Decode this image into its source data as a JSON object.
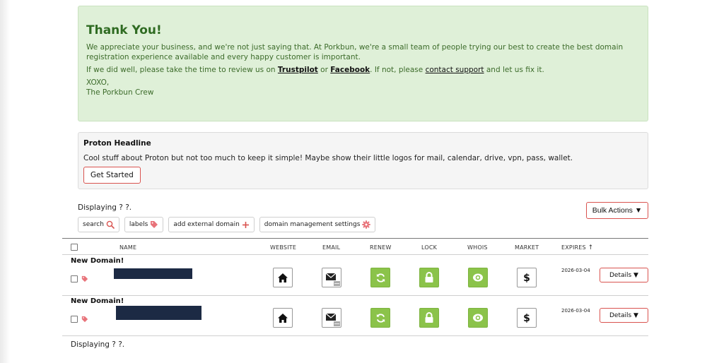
{
  "thanks": {
    "title": "Thank You!",
    "para1": "We appreciate your business, and we're not just saying that. At Porkbun, we're a small team of people trying our best to create the best domain registration experience available and every happy customer is important.",
    "review_prefix": "If we did well, please take the time to review us on ",
    "trustpilot": "Trustpilot",
    "or": " or ",
    "facebook": "Facebook",
    "mid": ". If not, please ",
    "contact_support": "contact support",
    "suffix": " and let us fix it.",
    "xoxo": "XOXO,",
    "crew": "The Porkbun Crew"
  },
  "proton": {
    "headline": "Proton Headline",
    "body": "Cool stuff about Proton but not too much to keep it simple! Maybe show their little logos for mail, calendar, drive, vpn, pass, wallet.",
    "button": "Get Started"
  },
  "list": {
    "displaying": "Displaying ? ?.",
    "bulk_actions": "Bulk Actions ▼",
    "filters": {
      "search": "search",
      "labels": "labels",
      "add_external": "add external domain",
      "settings": "domain management settings"
    }
  },
  "table": {
    "headers": {
      "name": "NAME",
      "website": "WEBSITE",
      "email": "EMAIL",
      "renew": "RENEW",
      "lock": "LOCK",
      "whois": "WHOIS",
      "market": "MARKET",
      "expires": "EXPIRES"
    },
    "rows": [
      {
        "title": "New Domain!",
        "expires": "2026-03-04",
        "details": "Details ▼"
      },
      {
        "title": "New Domain!",
        "expires": "2026-03-04",
        "details": "Details ▼"
      }
    ]
  },
  "colors": {
    "green_bg": "#dff0d8",
    "accent_red": "#d9534f",
    "action_green": "#8bc34a",
    "redaction": "#1c2a44"
  }
}
